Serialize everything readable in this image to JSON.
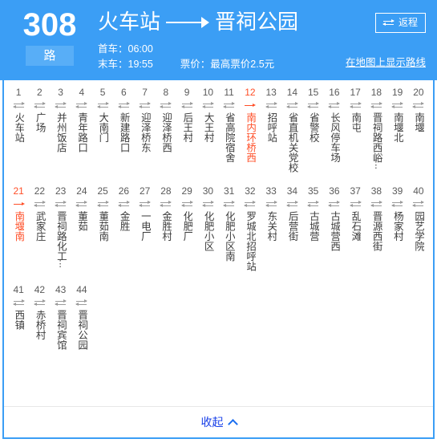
{
  "header": {
    "route_number": "308",
    "route_suffix": "路",
    "origin": "火车站",
    "destination": "晋祠公园",
    "first_bus_label": "首车：06:00",
    "last_bus_label": "末车：19:55",
    "fare_label": "票价：最高票价2.5元",
    "return_button_label": "返程",
    "return_button_icon": "bidirectional-arrow-icon",
    "map_link_label": "在地图上显示路线",
    "direction_arrow_icon": "long-right-arrow-icon",
    "bg_color": "#3b9ef5",
    "badge_bg_color": "#58aef7"
  },
  "stations": {
    "highlight_color": "#ff4f28",
    "default_icon": "bidirectional-arrow-icon",
    "highlight_icon": "one-way-arrow-icon",
    "items": [
      {
        "num": "1",
        "name": "火车站",
        "highlight": false,
        "truncated": false
      },
      {
        "num": "2",
        "name": "广场",
        "highlight": false,
        "truncated": false
      },
      {
        "num": "3",
        "name": "并州饭店",
        "highlight": false,
        "truncated": false
      },
      {
        "num": "4",
        "name": "青年路口",
        "highlight": false,
        "truncated": false
      },
      {
        "num": "5",
        "name": "大南门",
        "highlight": false,
        "truncated": false
      },
      {
        "num": "6",
        "name": "新建路口",
        "highlight": false,
        "truncated": false
      },
      {
        "num": "7",
        "name": "迎泽桥东",
        "highlight": false,
        "truncated": false
      },
      {
        "num": "8",
        "name": "迎泽桥西",
        "highlight": false,
        "truncated": false
      },
      {
        "num": "9",
        "name": "后王村",
        "highlight": false,
        "truncated": false
      },
      {
        "num": "10",
        "name": "大王村",
        "highlight": false,
        "truncated": false
      },
      {
        "num": "11",
        "name": "省高院宿舍",
        "highlight": false,
        "truncated": false
      },
      {
        "num": "12",
        "name": "南内环桥西",
        "highlight": true,
        "truncated": false
      },
      {
        "num": "13",
        "name": "招呼站",
        "highlight": false,
        "truncated": false
      },
      {
        "num": "14",
        "name": "省直机关党校",
        "highlight": false,
        "truncated": false
      },
      {
        "num": "15",
        "name": "省警校",
        "highlight": false,
        "truncated": false
      },
      {
        "num": "16",
        "name": "长风停车场",
        "highlight": false,
        "truncated": false
      },
      {
        "num": "17",
        "name": "南屯",
        "highlight": false,
        "truncated": false
      },
      {
        "num": "18",
        "name": "晋祠路西峪",
        "highlight": false,
        "truncated": true
      },
      {
        "num": "19",
        "name": "南堰北",
        "highlight": false,
        "truncated": false
      },
      {
        "num": "20",
        "name": "南堰",
        "highlight": false,
        "truncated": false
      },
      {
        "num": "21",
        "name": "南堰南",
        "highlight": true,
        "truncated": false
      },
      {
        "num": "22",
        "name": "武家庄",
        "highlight": false,
        "truncated": false
      },
      {
        "num": "23",
        "name": "晋祠路化工",
        "highlight": false,
        "truncated": true
      },
      {
        "num": "24",
        "name": "董茹",
        "highlight": false,
        "truncated": false
      },
      {
        "num": "25",
        "name": "董茹南",
        "highlight": false,
        "truncated": false
      },
      {
        "num": "26",
        "name": "金胜",
        "highlight": false,
        "truncated": false
      },
      {
        "num": "27",
        "name": "一电厂",
        "highlight": false,
        "truncated": false
      },
      {
        "num": "28",
        "name": "金胜村",
        "highlight": false,
        "truncated": false
      },
      {
        "num": "29",
        "name": "化肥厂",
        "highlight": false,
        "truncated": false
      },
      {
        "num": "30",
        "name": "化肥小区",
        "highlight": false,
        "truncated": false
      },
      {
        "num": "31",
        "name": "化肥小区南",
        "highlight": false,
        "truncated": false
      },
      {
        "num": "32",
        "name": "罗城北招呼站",
        "highlight": false,
        "truncated": false
      },
      {
        "num": "33",
        "name": "东关村",
        "highlight": false,
        "truncated": false
      },
      {
        "num": "34",
        "name": "后营街",
        "highlight": false,
        "truncated": false
      },
      {
        "num": "35",
        "name": "古城营",
        "highlight": false,
        "truncated": false
      },
      {
        "num": "36",
        "name": "古城营西",
        "highlight": false,
        "truncated": false
      },
      {
        "num": "37",
        "name": "乱石滩",
        "highlight": false,
        "truncated": false
      },
      {
        "num": "38",
        "name": "晋源西街",
        "highlight": false,
        "truncated": false
      },
      {
        "num": "39",
        "name": "杨家村",
        "highlight": false,
        "truncated": false
      },
      {
        "num": "40",
        "name": "园艺学院",
        "highlight": false,
        "truncated": false
      },
      {
        "num": "41",
        "name": "西镇",
        "highlight": false,
        "truncated": false
      },
      {
        "num": "42",
        "name": "赤桥村",
        "highlight": false,
        "truncated": false
      },
      {
        "num": "43",
        "name": "晋祠宾馆",
        "highlight": false,
        "truncated": false
      },
      {
        "num": "44",
        "name": "晋祠公园",
        "highlight": false,
        "truncated": false
      }
    ]
  },
  "footer": {
    "collapse_label": "收起",
    "collapse_icon": "chevron-up-icon"
  }
}
